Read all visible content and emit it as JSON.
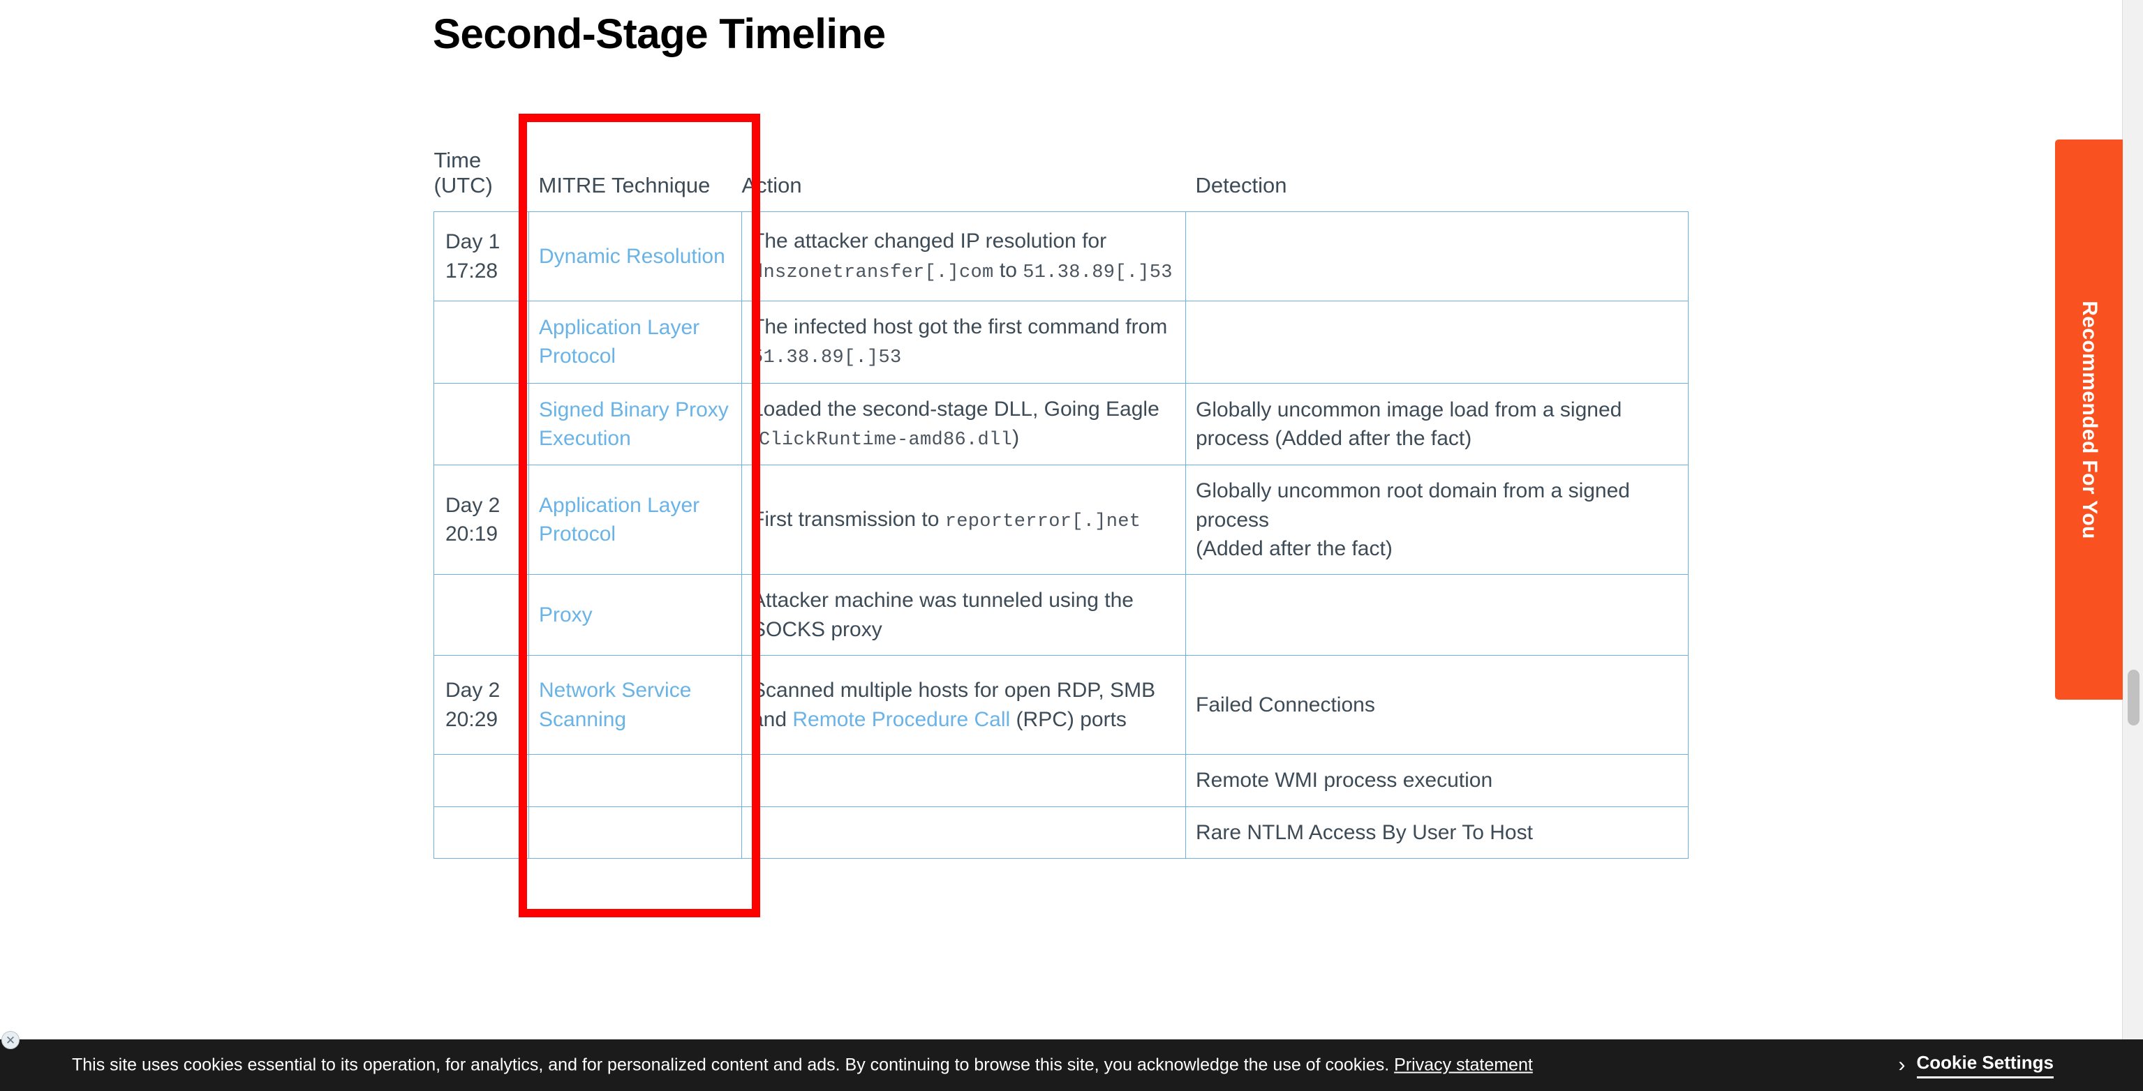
{
  "page": {
    "title": "Second-Stage Timeline"
  },
  "table": {
    "headers": {
      "time": "Time (UTC)",
      "time_line1": "Time",
      "time_line2": "(UTC)",
      "technique": "MITRE Technique",
      "action": "Action",
      "detection": "Detection"
    },
    "rows": [
      {
        "time": "Day 1 17:28",
        "time_line1": "Day 1",
        "time_line2": "17:28",
        "technique": "Dynamic Resolution",
        "action_parts": [
          {
            "type": "text",
            "value": "The attacker changed IP resolution for "
          },
          {
            "type": "code",
            "value": "dnszonetransfer[.]com"
          },
          {
            "type": "text",
            "value": " to "
          },
          {
            "type": "code",
            "value": "51.38.89[.]53"
          }
        ],
        "detection": ""
      },
      {
        "time": "",
        "technique": "Application Layer Protocol",
        "action_parts": [
          {
            "type": "text",
            "value": "The infected host got the first command from "
          },
          {
            "type": "code",
            "value": "51.38.89[.]53"
          }
        ],
        "detection": ""
      },
      {
        "time": "Day 2 20:19",
        "time_line1": "Day 2",
        "time_line2": "20:19",
        "technique": "Signed Binary Proxy Execution",
        "action_parts": [
          {
            "type": "text",
            "value": "Loaded the second-stage DLL, Going Eagle ("
          },
          {
            "type": "code",
            "value": "ClickRuntime-amd86.dll"
          },
          {
            "type": "text",
            "value": ")"
          }
        ],
        "detection": "Globally uncommon image load from a signed process (Added after the fact)"
      },
      {
        "time": "",
        "technique": "Application Layer Protocol",
        "action_parts": [
          {
            "type": "text",
            "value": "First transmission to "
          },
          {
            "type": "code",
            "value": "reporterror[.]net"
          }
        ],
        "detection_line1": "Globally uncommon root domain from a signed process",
        "detection_line2": "(Added after the fact)"
      },
      {
        "time": "",
        "technique": "Proxy",
        "action_parts": [
          {
            "type": "text",
            "value": "Attacker machine was tunneled using the SOCKS proxy"
          }
        ],
        "detection": ""
      },
      {
        "time": "Day 2 20:29",
        "time_line1": "Day 2",
        "time_line2": "20:29",
        "technique": "Network Service Scanning",
        "action_parts": [
          {
            "type": "text",
            "value": "Scanned multiple hosts for open RDP, SMB and "
          },
          {
            "type": "link",
            "value": "Remote Procedure Call"
          },
          {
            "type": "text",
            "value": " (RPC) ports"
          }
        ],
        "detection": "Failed Connections"
      },
      {
        "time": "",
        "technique": "",
        "action_parts": [],
        "detection": "Remote WMI process execution"
      },
      {
        "time": "",
        "technique": "",
        "action_parts": [],
        "detection": "Rare NTLM Access By User To Host"
      }
    ]
  },
  "annotation": {
    "color": "#ff0000",
    "target": "MITRE Technique column"
  },
  "recommended_tab": {
    "label": "Recommended For You",
    "color": "#f9511f"
  },
  "cookie_banner": {
    "text": "This site uses cookies essential to its operation, for analytics, and for personalized content and ads. By continuing to browse this site, you acknowledge the use of cookies.",
    "privacy_link": "Privacy statement",
    "settings_label": "Cookie Settings",
    "chevron": "›",
    "close_icon": "✕"
  }
}
